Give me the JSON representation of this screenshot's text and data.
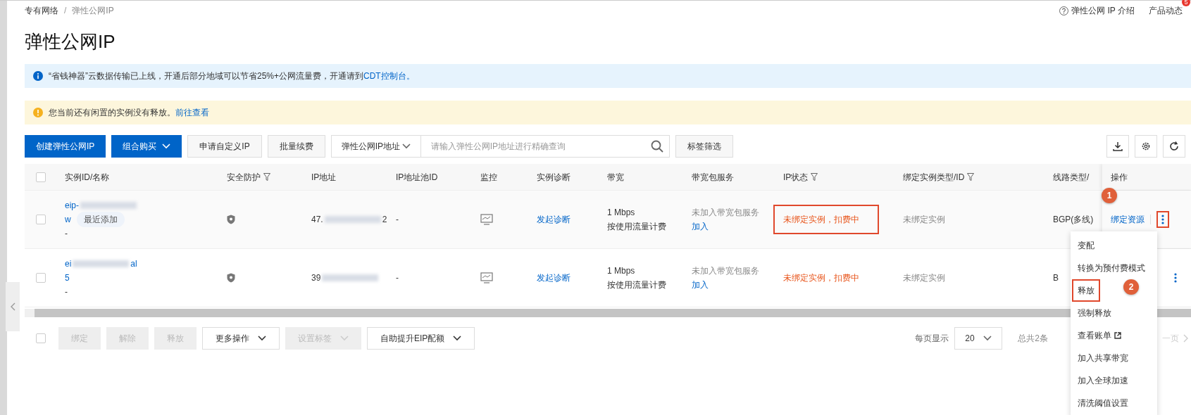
{
  "breadcrumb": [
    "专有网络",
    "弹性公网IP"
  ],
  "breadcrumb_separator": "/",
  "header_links": [
    {
      "kind": "help",
      "text": "弹性公网 IP 介绍"
    },
    {
      "kind": "news",
      "text": "产品动态",
      "badge": "5"
    }
  ],
  "title": "弹性公网IP",
  "notices": [
    {
      "kind": "info",
      "text": "“省钱神器”云数据传输已上线，开通后部分地域可以节省25%+公网流量费，开通请到",
      "link": "CDT控制台。"
    },
    {
      "kind": "warning",
      "text": "您当前还有闲置的实例没有释放。",
      "link": "前往查看"
    }
  ],
  "toolbar": {
    "buttons": [
      {
        "label": "创建弹性公网IP",
        "kind": "primary",
        "dropdown": false
      },
      {
        "label": "组合购买",
        "kind": "primary",
        "dropdown": true
      },
      {
        "label": "申请自定义IP",
        "kind": "default",
        "dropdown": false
      },
      {
        "label": "批量续费",
        "kind": "default",
        "dropdown": false
      }
    ],
    "search_type": "弹性公网IP地址",
    "search_placeholder": "请输入弹性公网IP地址进行精确查询",
    "tag_filter": "标签筛选"
  },
  "table": {
    "columns": [
      {
        "label": "实例ID/名称",
        "filter": false
      },
      {
        "label": "安全防护",
        "filter": true
      },
      {
        "label": "IP地址",
        "filter": false
      },
      {
        "label": "IP地址池ID",
        "filter": false
      },
      {
        "label": "监控",
        "filter": false
      },
      {
        "label": "实例诊断",
        "filter": false
      },
      {
        "label": "带宽",
        "filter": false
      },
      {
        "label": "带宽包服务",
        "filter": false
      },
      {
        "label": "IP状态",
        "filter": true
      },
      {
        "label": "绑定实例类型/ID",
        "filter": true
      },
      {
        "label": "线路类型/",
        "filter": false
      },
      {
        "label": "操作",
        "filter": false
      }
    ],
    "header_checked": false,
    "rows": [
      {
        "checked": false,
        "hovered": true,
        "id_lines": [
          [
            {
              "kind": "text",
              "text": "eip-"
            },
            {
              "kind": "redacted"
            }
          ],
          [
            {
              "kind": "text",
              "text": "w"
            },
            {
              "kind": "tag",
              "text": "最近添加"
            }
          ]
        ],
        "name": "-",
        "ip": [
          {
            "kind": "text",
            "text": "47."
          },
          {
            "kind": "redacted"
          },
          {
            "kind": "text",
            "text": "2"
          }
        ],
        "pool": "-",
        "diagnose": "发起诊断",
        "bandwidth": "1 Mbps",
        "billing": "按使用流量计费",
        "package": "未加入带宽包服务",
        "package_link": "加入",
        "status": "未绑定实例，扣费中",
        "status_annotated": true,
        "binding": "未绑定实例",
        "line": "BGP(多线)",
        "action": "绑定资源"
      },
      {
        "checked": false,
        "hovered": false,
        "id_lines": [
          [
            {
              "kind": "text",
              "text": "ei"
            },
            {
              "kind": "redacted"
            },
            {
              "kind": "text",
              "text": "al"
            }
          ],
          [
            {
              "kind": "text",
              "text": "5"
            }
          ]
        ],
        "name": "-",
        "ip": [
          {
            "kind": "text",
            "text": "39"
          },
          {
            "kind": "redacted"
          }
        ],
        "pool": "-",
        "diagnose": "发起诊断",
        "bandwidth": "1 Mbps",
        "billing": "按使用流量计费",
        "package": "未加入带宽包服务",
        "package_link": "加入",
        "status": "未绑定实例，扣费中",
        "status_annotated": false,
        "binding": "未绑定实例",
        "line": "B"
      }
    ]
  },
  "footer": {
    "checked": false,
    "buttons": [
      {
        "label": "绑定",
        "disabled": true,
        "dropdown": false
      },
      {
        "label": "解除",
        "disabled": true,
        "dropdown": false
      },
      {
        "label": "释放",
        "disabled": true,
        "dropdown": false
      },
      {
        "label": "更多操作",
        "disabled": false,
        "dropdown": true
      },
      {
        "label": "设置标签",
        "disabled": true,
        "dropdown": true
      },
      {
        "label": "自助提升EIP配额",
        "disabled": false,
        "dropdown": true
      }
    ],
    "page_size_label": "每页显示",
    "page_size": "20",
    "total": "总共2条",
    "next_page": "一页"
  },
  "menu": {
    "items": [
      {
        "label": "变配",
        "annotated": false,
        "external": false
      },
      {
        "label": "转换为预付费模式",
        "annotated": false,
        "external": false
      },
      {
        "label": "释放",
        "annotated": true,
        "external": false
      },
      {
        "label": "强制释放",
        "annotated": false,
        "external": false
      },
      {
        "label": "查看账单",
        "annotated": false,
        "external": true
      },
      {
        "label": "加入共享带宽",
        "annotated": false,
        "external": false
      },
      {
        "label": "加入全球加速",
        "annotated": false,
        "external": false
      },
      {
        "label": "清洗阈值设置",
        "annotated": false,
        "external": false
      }
    ]
  },
  "annotations": [
    "1",
    "2"
  ]
}
